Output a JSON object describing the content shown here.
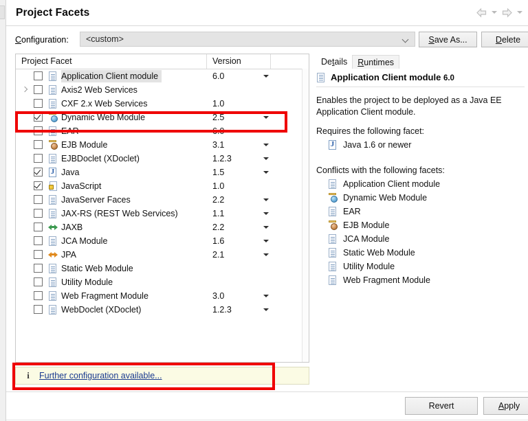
{
  "window": {
    "title": "Project Facets",
    "nav": {
      "back_icon": "back-arrow-icon",
      "back_caret_icon": "chevron-down-icon",
      "forward_icon": "forward-arrow-icon",
      "forward_caret_icon": "chevron-down-icon"
    }
  },
  "configuration": {
    "label": "Configuration:",
    "label_mnemonic": "C",
    "value": "<custom>",
    "chevron_icon": "chevron-down-icon",
    "save_as_label": "Save As...",
    "save_as_mnemonic": "S",
    "delete_label": "Delete",
    "delete_mnemonic": "D"
  },
  "facet_list": {
    "columns": {
      "facet": "Project Facet",
      "version": "Version"
    },
    "rows": [
      {
        "name": "Application Client module",
        "version": "6.0",
        "checked": false,
        "icon": "doc-icon",
        "has_version_arrow": true,
        "selected": true,
        "expandable": false
      },
      {
        "name": "Axis2 Web Services",
        "version": "",
        "checked": false,
        "icon": "doc-icon",
        "has_version_arrow": false,
        "selected": false,
        "expandable": true
      },
      {
        "name": "CXF 2.x Web Services",
        "version": "1.0",
        "checked": false,
        "icon": "doc-icon",
        "has_version_arrow": false,
        "selected": false,
        "expandable": false
      },
      {
        "name": "Dynamic Web Module",
        "version": "2.5",
        "checked": true,
        "icon": "globe-icon",
        "has_version_arrow": true,
        "selected": false,
        "expandable": false
      },
      {
        "name": "EAR",
        "version": "6.0",
        "checked": false,
        "icon": "doc-icon",
        "has_version_arrow": true,
        "selected": false,
        "expandable": false
      },
      {
        "name": "EJB Module",
        "version": "3.1",
        "checked": false,
        "icon": "ejb-icon",
        "has_version_arrow": true,
        "selected": false,
        "expandable": false
      },
      {
        "name": "EJBDoclet (XDoclet)",
        "version": "1.2.3",
        "checked": false,
        "icon": "doc-icon",
        "has_version_arrow": true,
        "selected": false,
        "expandable": false
      },
      {
        "name": "Java",
        "version": "1.5",
        "checked": true,
        "icon": "java-icon",
        "has_version_arrow": true,
        "selected": false,
        "expandable": false
      },
      {
        "name": "JavaScript",
        "version": "1.0",
        "checked": true,
        "icon": "locked-doc-icon",
        "has_version_arrow": false,
        "selected": false,
        "expandable": false
      },
      {
        "name": "JavaServer Faces",
        "version": "2.2",
        "checked": false,
        "icon": "doc-icon",
        "has_version_arrow": true,
        "selected": false,
        "expandable": false
      },
      {
        "name": "JAX-RS (REST Web Services)",
        "version": "1.1",
        "checked": false,
        "icon": "doc-icon",
        "has_version_arrow": true,
        "selected": false,
        "expandable": false
      },
      {
        "name": "JAXB",
        "version": "2.2",
        "checked": false,
        "icon": "arrows-green-icon",
        "has_version_arrow": true,
        "selected": false,
        "expandable": false
      },
      {
        "name": "JCA Module",
        "version": "1.6",
        "checked": false,
        "icon": "doc-icon",
        "has_version_arrow": true,
        "selected": false,
        "expandable": false
      },
      {
        "name": "JPA",
        "version": "2.1",
        "checked": false,
        "icon": "arrows-orange-icon",
        "has_version_arrow": true,
        "selected": false,
        "expandable": false
      },
      {
        "name": "Static Web Module",
        "version": "",
        "checked": false,
        "icon": "doc-icon",
        "has_version_arrow": false,
        "selected": false,
        "expandable": false
      },
      {
        "name": "Utility Module",
        "version": "",
        "checked": false,
        "icon": "doc-icon",
        "has_version_arrow": false,
        "selected": false,
        "expandable": false
      },
      {
        "name": "Web Fragment Module",
        "version": "3.0",
        "checked": false,
        "icon": "doc-icon",
        "has_version_arrow": true,
        "selected": false,
        "expandable": false
      },
      {
        "name": "WebDoclet (XDoclet)",
        "version": "1.2.3",
        "checked": false,
        "icon": "doc-icon",
        "has_version_arrow": true,
        "selected": false,
        "expandable": false
      }
    ]
  },
  "details": {
    "tabs": [
      {
        "label": "Details",
        "mnemonic": "t",
        "active": true
      },
      {
        "label": "Runtimes",
        "mnemonic": "R",
        "active": false
      }
    ],
    "heading": "Application Client module",
    "heading_version": "6.0",
    "heading_icon": "doc-icon",
    "description": "Enables the project to be deployed as a Java EE Application Client module.",
    "requires_label": "Requires the following facet:",
    "requires": [
      {
        "name": "Java 1.6 or newer",
        "icon": "java-icon"
      }
    ],
    "conflicts_label": "Conflicts with the following facets:",
    "conflicts": [
      {
        "name": "Application Client module",
        "icon": "doc-icon"
      },
      {
        "name": "Dynamic Web Module",
        "icon": "globe-icon"
      },
      {
        "name": "EAR",
        "icon": "doc-icon"
      },
      {
        "name": "EJB Module",
        "icon": "ejb-icon"
      },
      {
        "name": "JCA Module",
        "icon": "doc-icon"
      },
      {
        "name": "Static Web Module",
        "icon": "doc-icon"
      },
      {
        "name": "Utility Module",
        "icon": "doc-icon"
      },
      {
        "name": "Web Fragment Module",
        "icon": "doc-icon"
      }
    ]
  },
  "info_bar": {
    "icon": "info-icon",
    "icon_glyph": "i",
    "link_text": "Further configuration available..."
  },
  "footer": {
    "revert_label": "Revert",
    "apply_label": "Apply",
    "apply_mnemonic": "A"
  },
  "annotations": {
    "color": "#ef0000",
    "boxes": [
      "dynamic-web-module-row",
      "further-configuration-bar"
    ]
  }
}
